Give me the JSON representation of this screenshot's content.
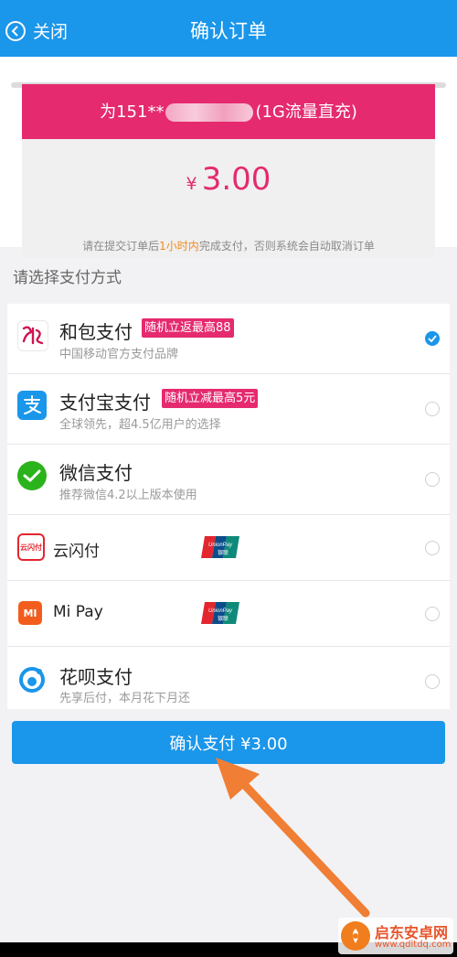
{
  "header": {
    "back_label": "关闭",
    "title": "确认订单"
  },
  "order": {
    "recharge_prefix": "为151**",
    "recharge_suffix": "(1G流量直充)",
    "currency": "¥",
    "amount": "3.00",
    "notice_before": "请在提交订单后",
    "notice_highlight": "1小时内",
    "notice_after": "完成支付，否则系统会自动取消订单"
  },
  "payment": {
    "section_title": "请选择支付方式",
    "methods": [
      {
        "name": "和包支付",
        "tag": "随机立返最高88",
        "desc": "中国移动官方支付品牌",
        "selected": true,
        "icon": "hebao-icon"
      },
      {
        "name": "支付宝支付",
        "tag": "随机立减最高5元",
        "desc": "全球领先，超4.5亿用户的选择",
        "selected": false,
        "icon": "alipay-icon"
      },
      {
        "name": "微信支付",
        "tag": "",
        "desc": "推荐微信4.2以上版本使用",
        "selected": false,
        "icon": "wechat-pay-icon"
      },
      {
        "name": "云闪付",
        "tag": "",
        "desc": "",
        "selected": false,
        "icon": "cloud-quickpass-icon",
        "icon_text": "云闪付"
      },
      {
        "name": "Mi Pay",
        "tag": "",
        "desc": "",
        "selected": false,
        "icon": "mi-icon",
        "icon_text": "MI"
      },
      {
        "name": "花呗支付",
        "tag": "",
        "desc": "先享后付，本月花下月还",
        "selected": false,
        "icon": "huabei-icon"
      }
    ],
    "unionpay_label": "UnionPay",
    "unionpay_cn": "银联"
  },
  "confirm_button": "确认支付 ¥3.00",
  "watermark": {
    "name": "启东安卓网",
    "url": "www.qdltdq.com"
  },
  "colors": {
    "brand_blue": "#1a96ea",
    "promo_pink": "#e52a6f",
    "highlight_orange": "#f08c1e",
    "arrow_orange": "#f07e34"
  }
}
